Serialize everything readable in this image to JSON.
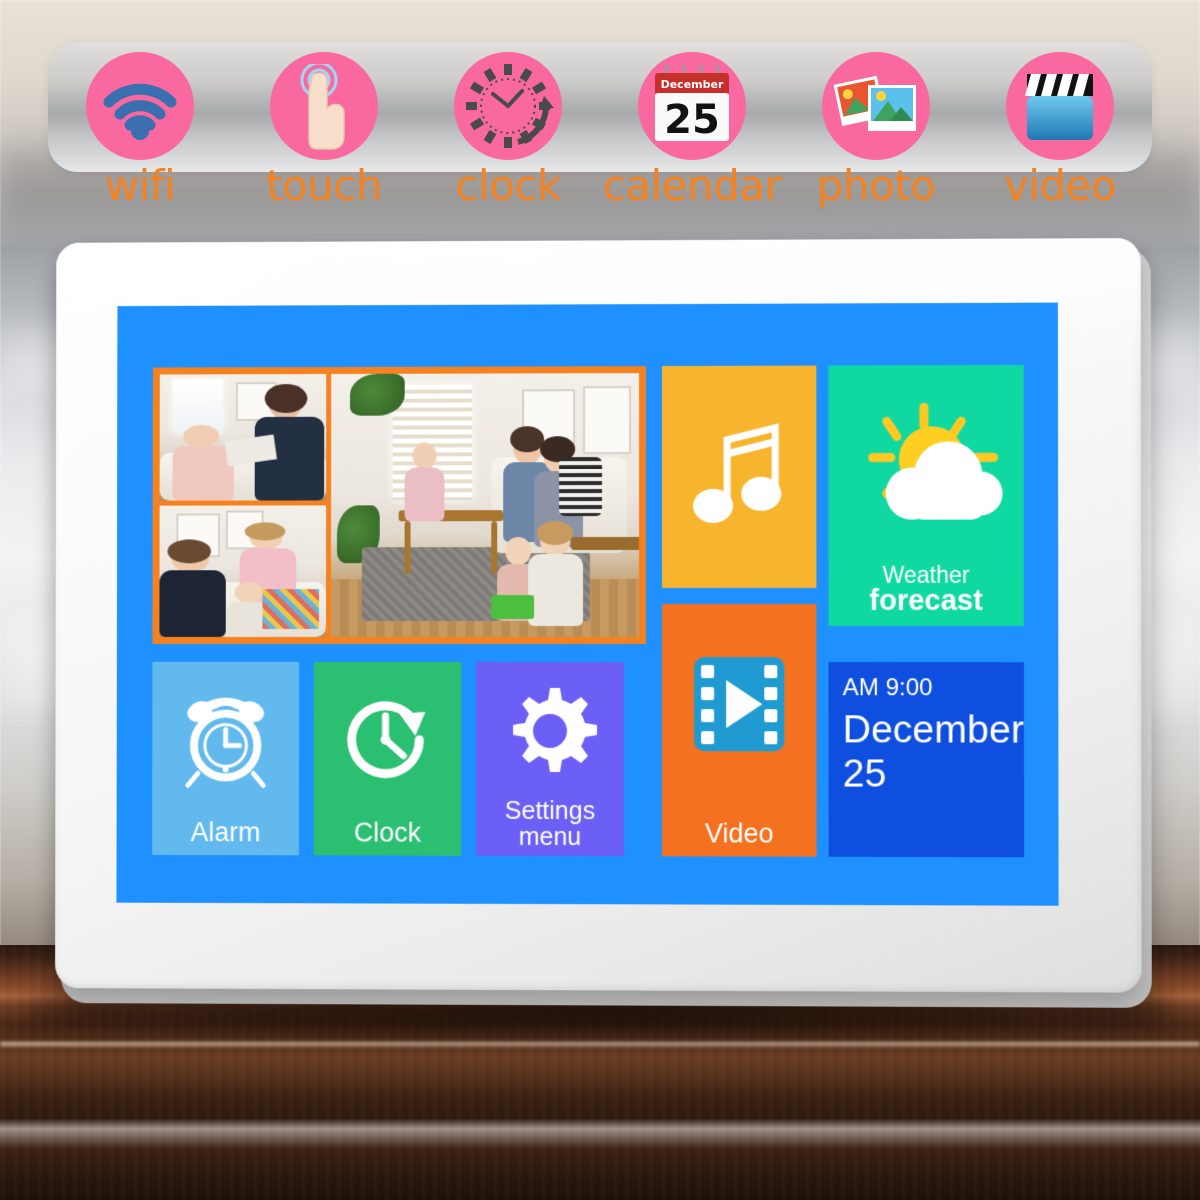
{
  "features": [
    {
      "id": "wifi",
      "label": "wifi",
      "icon": "wifi-icon"
    },
    {
      "id": "touch",
      "label": "touch",
      "icon": "touch-finger-icon"
    },
    {
      "id": "clock",
      "label": "clock",
      "icon": "clock-icon"
    },
    {
      "id": "calendar",
      "label": "calendar",
      "icon": "calendar-icon",
      "month": "December",
      "day": "25"
    },
    {
      "id": "photo",
      "label": "photo",
      "icon": "photos-icon"
    },
    {
      "id": "video",
      "label": "video",
      "icon": "clapperboard-icon"
    }
  ],
  "screen": {
    "background_color": "#1E90FF",
    "photo_collage": {
      "name": "photo-collage",
      "border_color": "#F5821F",
      "photo_count": 3
    },
    "tiles": {
      "music": {
        "label": "",
        "color": "#F7B52E",
        "icon": "music-note-icon"
      },
      "weather": {
        "line1": "Weather",
        "line2": "forecast",
        "color": "#0FD9A0",
        "icon": "sun-cloud-icon"
      },
      "alarm": {
        "label": "Alarm",
        "color": "#61B9EE",
        "icon": "alarm-clock-icon"
      },
      "clock": {
        "label": "Clock",
        "color": "#2BBF72",
        "icon": "clock-refresh-icon"
      },
      "settings": {
        "line1": "Settings",
        "line2": "menu",
        "color": "#6B5FF5",
        "icon": "gear-icon"
      },
      "video": {
        "label": "Video",
        "color": "#F4711F",
        "icon": "film-play-icon"
      },
      "date": {
        "time": "AM 9:00",
        "month": "December",
        "day": "25",
        "color": "#0F4FE0"
      }
    }
  },
  "colors": {
    "badge_pink": "#F9699F",
    "label_orange": "#F58220",
    "screen_blue": "#1E90FF",
    "frame_white": "#FFFFFF"
  }
}
